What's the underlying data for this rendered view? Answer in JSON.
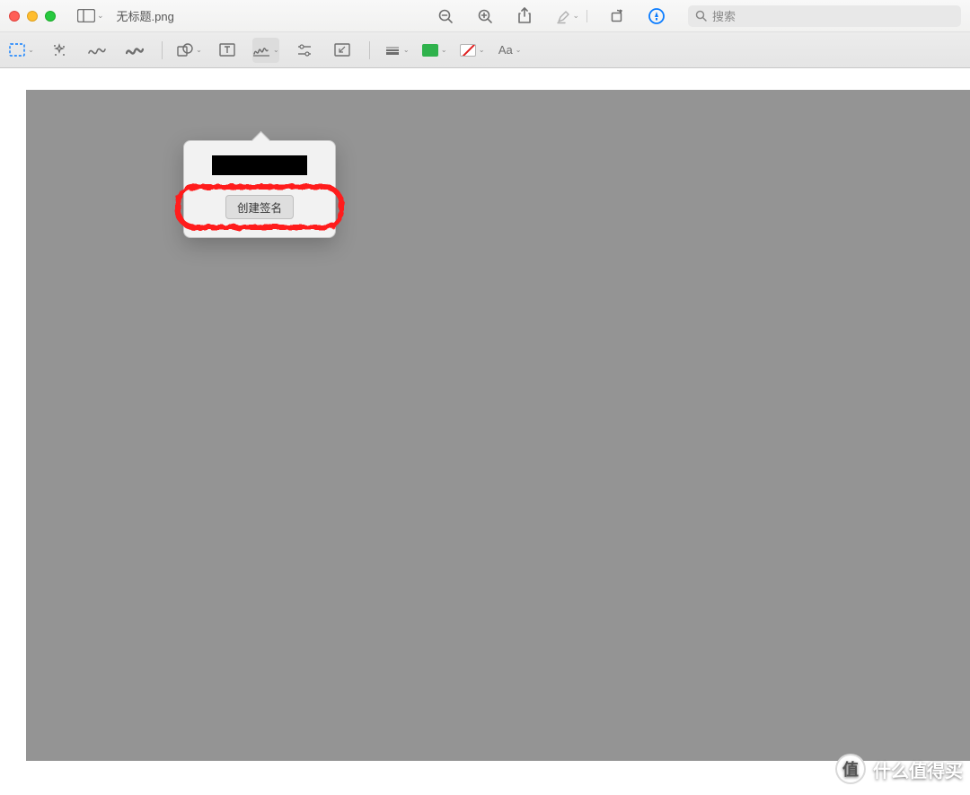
{
  "window": {
    "filename": "无标题.png"
  },
  "titlebar": {
    "search_placeholder": "搜索"
  },
  "toolbar": {
    "text_style_label": "Aa"
  },
  "popover": {
    "create_signature_label": "创建签名"
  },
  "watermark": {
    "badge_char": "值",
    "text": "什么值得买"
  },
  "colors": {
    "accent_blue": "#0a7cff",
    "fill_swatch": "#2fb24c",
    "highlight_red": "#ff1a1a",
    "canvas_gray": "#949494"
  }
}
